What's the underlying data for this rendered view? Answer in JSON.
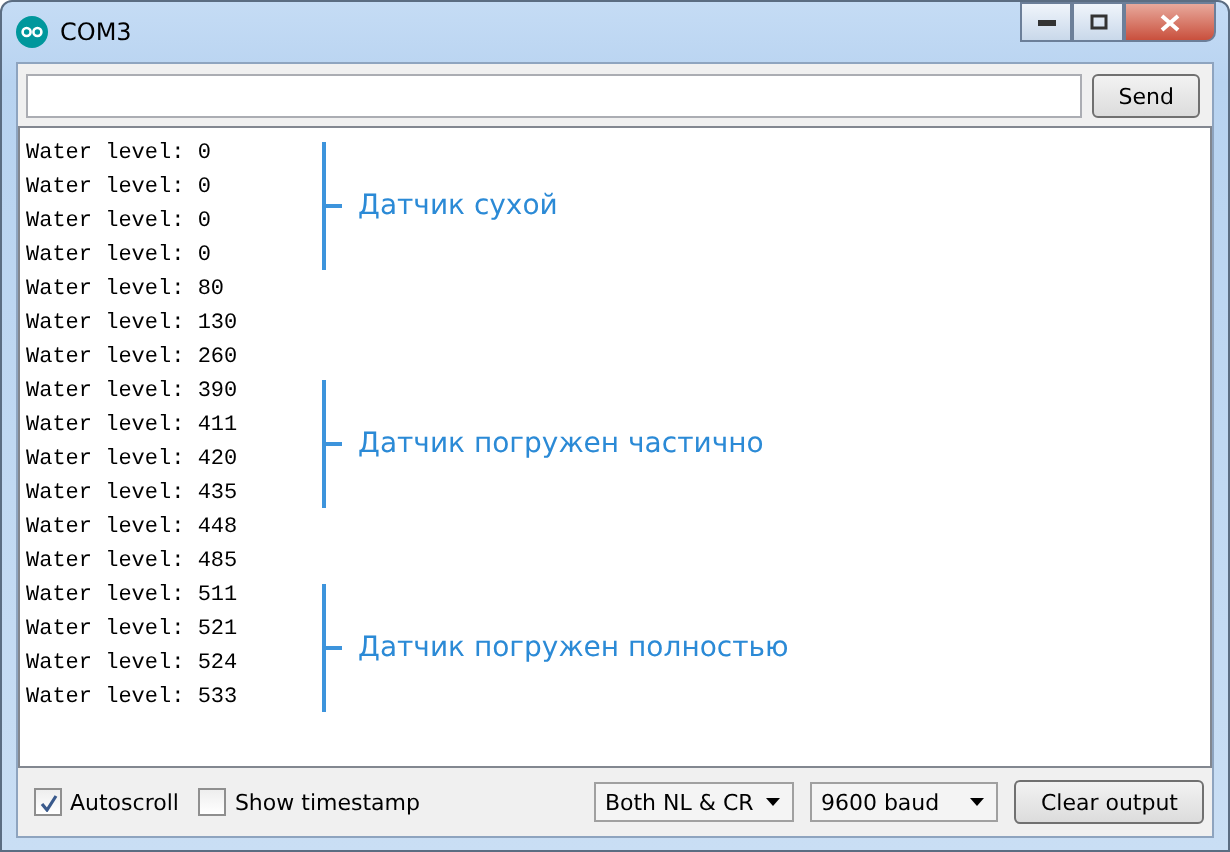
{
  "window": {
    "title": "COM3"
  },
  "input": {
    "button": "Send"
  },
  "output": [
    {
      "lines": [
        "Water level: 0",
        "Water level: 0",
        "Water level: 0",
        "Water level: 0"
      ],
      "note": "Датчик сухой"
    },
    {
      "lines": [
        "Water level: 80",
        "Water level: 130",
        "Water level: 260"
      ]
    },
    {
      "lines": [
        "Water level: 390",
        "Water level: 411",
        "Water level: 420",
        "Water level: 435"
      ],
      "note": "Датчик погружен частично"
    },
    {
      "lines": [
        "Water level: 448",
        "Water level: 485"
      ]
    },
    {
      "lines": [
        "Water level: 511",
        "Water level: 521",
        "Water level: 524",
        "Water level: 533"
      ],
      "note": "Датчик погружен полностью"
    }
  ],
  "footer": {
    "checkboxes": [
      {
        "label": "Autoscroll",
        "checked": true
      },
      {
        "label": "Show timestamp",
        "checked": false
      }
    ],
    "dropdowns": [
      "Both NL & CR",
      "9600 baud"
    ],
    "button": "Clear output"
  }
}
